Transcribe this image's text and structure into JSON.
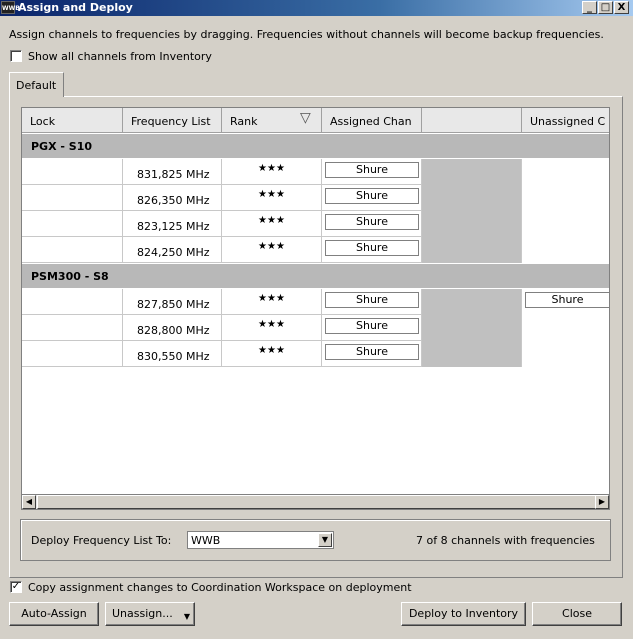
{
  "window": {
    "app_icon_text": "WWB",
    "title": "Assign and Deploy",
    "minimize": "_",
    "maximize": "□",
    "close": "X"
  },
  "instructions": "Assign channels to frequencies by dragging. Frequencies without channels will become backup frequencies.",
  "show_all_channels": {
    "label": "Show all channels from Inventory",
    "checked": false,
    "mark": ""
  },
  "tab": {
    "label": "Default"
  },
  "grid": {
    "headers": [
      "Lock",
      "Frequency List",
      "Rank",
      "Assigned Chan",
      "",
      "Unassigned C"
    ],
    "sort_icon": "▽",
    "groups": [
      {
        "name": "PGX - S10",
        "rows": [
          {
            "frequency": "831,825 MHz",
            "rank": "★★★",
            "assigned": "Shure",
            "unassigned": ""
          },
          {
            "frequency": "826,350 MHz",
            "rank": "★★★",
            "assigned": "Shure",
            "unassigned": ""
          },
          {
            "frequency": "823,125 MHz",
            "rank": "★★★",
            "assigned": "Shure",
            "unassigned": ""
          },
          {
            "frequency": "824,250 MHz",
            "rank": "★★★",
            "assigned": "Shure",
            "unassigned": ""
          }
        ]
      },
      {
        "name": "PSM300 - S8",
        "rows": [
          {
            "frequency": "827,850 MHz",
            "rank": "★★★",
            "assigned": "Shure",
            "unassigned": "Shure"
          },
          {
            "frequency": "828,800 MHz",
            "rank": "★★★",
            "assigned": "Shure",
            "unassigned": ""
          },
          {
            "frequency": "830,550 MHz",
            "rank": "★★★",
            "assigned": "Shure",
            "unassigned": ""
          }
        ]
      }
    ]
  },
  "scroll": {
    "left": "◀",
    "right": "▶"
  },
  "deploy": {
    "label": "Deploy Frequency List To:",
    "selected": "WWB",
    "arrow": "▼",
    "status": "7 of 8 channels with frequencies"
  },
  "copy_assignment": {
    "label": "Copy assignment changes to Coordination Workspace on deployment",
    "checked": true,
    "mark": "✓"
  },
  "buttons": {
    "auto_assign": "Auto-Assign",
    "unassign": "Unassign...",
    "unassign_arrow": "▼",
    "deploy_inventory": "Deploy to Inventory",
    "close": "Close"
  }
}
